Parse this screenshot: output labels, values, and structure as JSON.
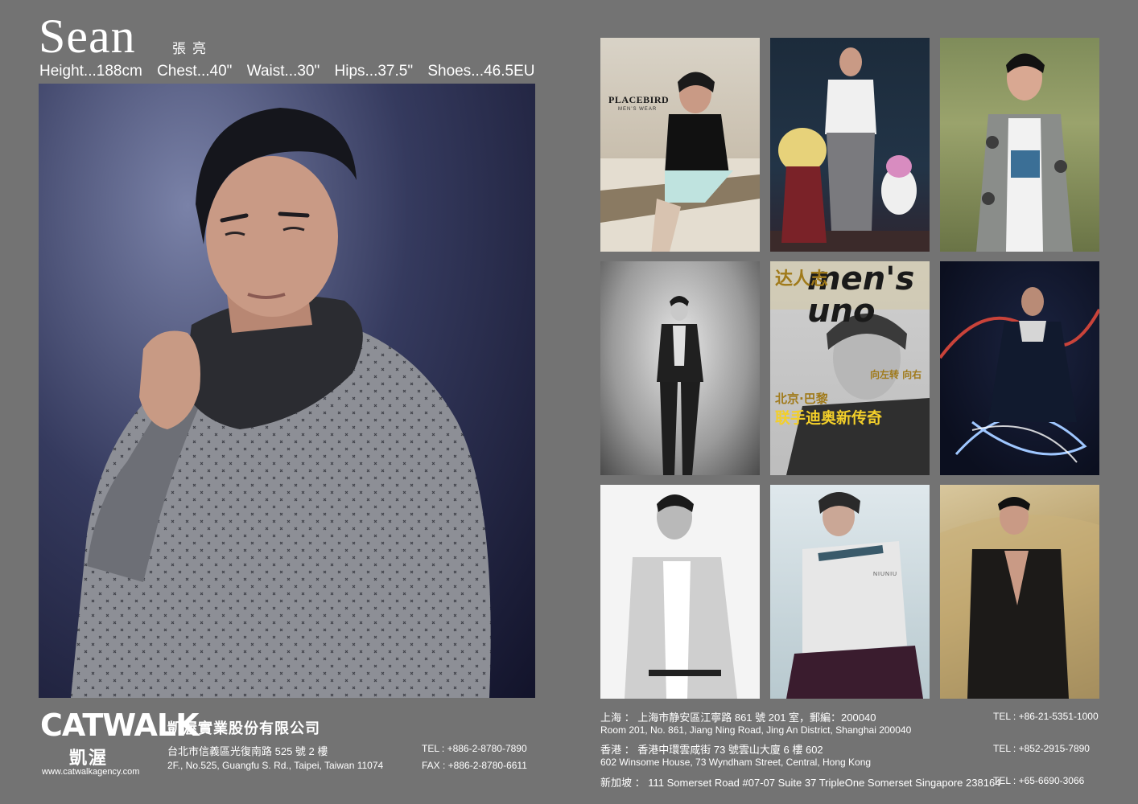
{
  "model": {
    "name": "Sean",
    "chinese_name": "張亮",
    "stats": [
      "Height...188cm",
      "Chest...40\"",
      "Waist...30\"",
      "Hips...37.5\"",
      "Shoes...46.5EU"
    ]
  },
  "thumbnails": {
    "t1": {
      "brand": "PLACEBIRD",
      "sub": "MEN'S WEAR"
    },
    "t5": {
      "title": "men's uno",
      "cn": "达人志",
      "headline": "北京·巴黎",
      "headline2": "联手迪奥新传奇",
      "side": "向左转 向右"
    },
    "t8": {
      "caption": "NIUNIU"
    }
  },
  "footer": {
    "logo": "CATWALK",
    "logo_cn": "凱渥",
    "url": "www.catwalkagency.com",
    "company": "凱渥實業股份有限公司",
    "address_cn": "台北市信義區光復南路 525 號 2 樓",
    "address_en": "2F., No.525, Guangfu S. Rd., Taipei, Taiwan 11074",
    "tel": "TEL : +886-2-8780-7890",
    "fax": "FAX : +886-2-8780-6611",
    "offices": [
      {
        "line1": "上海 ： 上海市静安區江寧路 861 號 201 室，郵編：200040",
        "line2": "Room 201, No. 861, Jiang Ning Road, Jing An District, Shanghai 200040",
        "tel": "TEL : +86-21-5351-1000"
      },
      {
        "line1": "香港 ： 香港中環雲咸街 73 號雲山大廈 6 樓 602",
        "line2": "602 Winsome House, 73 Wyndham Street, Central, Hong Kong",
        "tel": "TEL : +852-2915-7890"
      },
      {
        "line1": "新加坡 ： 111 Somerset Road #07-07 Suite 37 TripleOne Somerset Singapore 238164",
        "line2": "",
        "tel": "TEL : +65-6690-3066"
      }
    ]
  },
  "colors": {
    "page_bg": "#737373",
    "text": "#ffffff"
  }
}
